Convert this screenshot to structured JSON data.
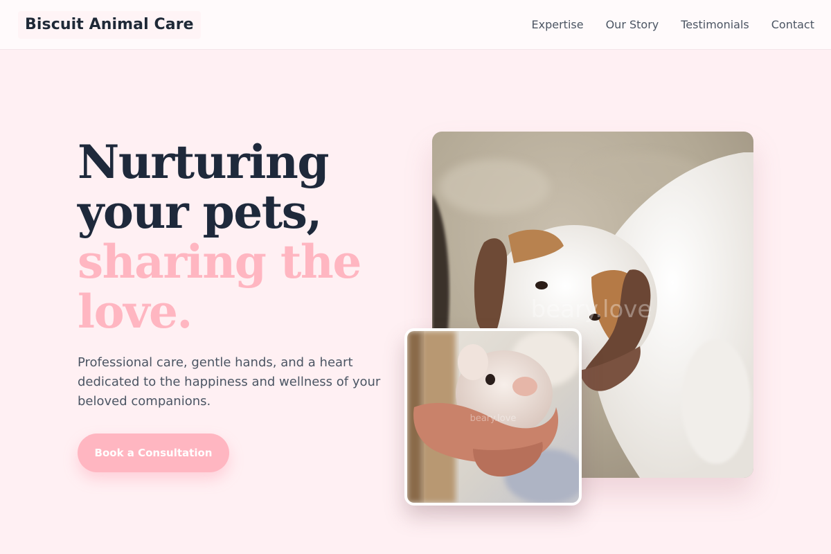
{
  "header": {
    "brand": "Biscuit Animal Care",
    "nav": [
      {
        "label": "Expertise"
      },
      {
        "label": "Our Story"
      },
      {
        "label": "Testimonials"
      },
      {
        "label": "Contact"
      }
    ]
  },
  "hero": {
    "headline_line1": "Nurturing",
    "headline_line2": "your pets,",
    "headline_accent_line1": "sharing the",
    "headline_accent_line2": "love.",
    "subtitle": "Professional care, gentle hands, and a heart dedicated to the happiness and wellness of your beloved companions.",
    "cta_label": "Book a Consultation"
  },
  "photos": {
    "main_watermark": "beary.love",
    "small_watermark": "beary.love"
  },
  "colors": {
    "background": "#fff0f3",
    "accent_pink": "#ffb6c1",
    "heading_dark": "#1e293b",
    "body_text": "#4b5563"
  }
}
